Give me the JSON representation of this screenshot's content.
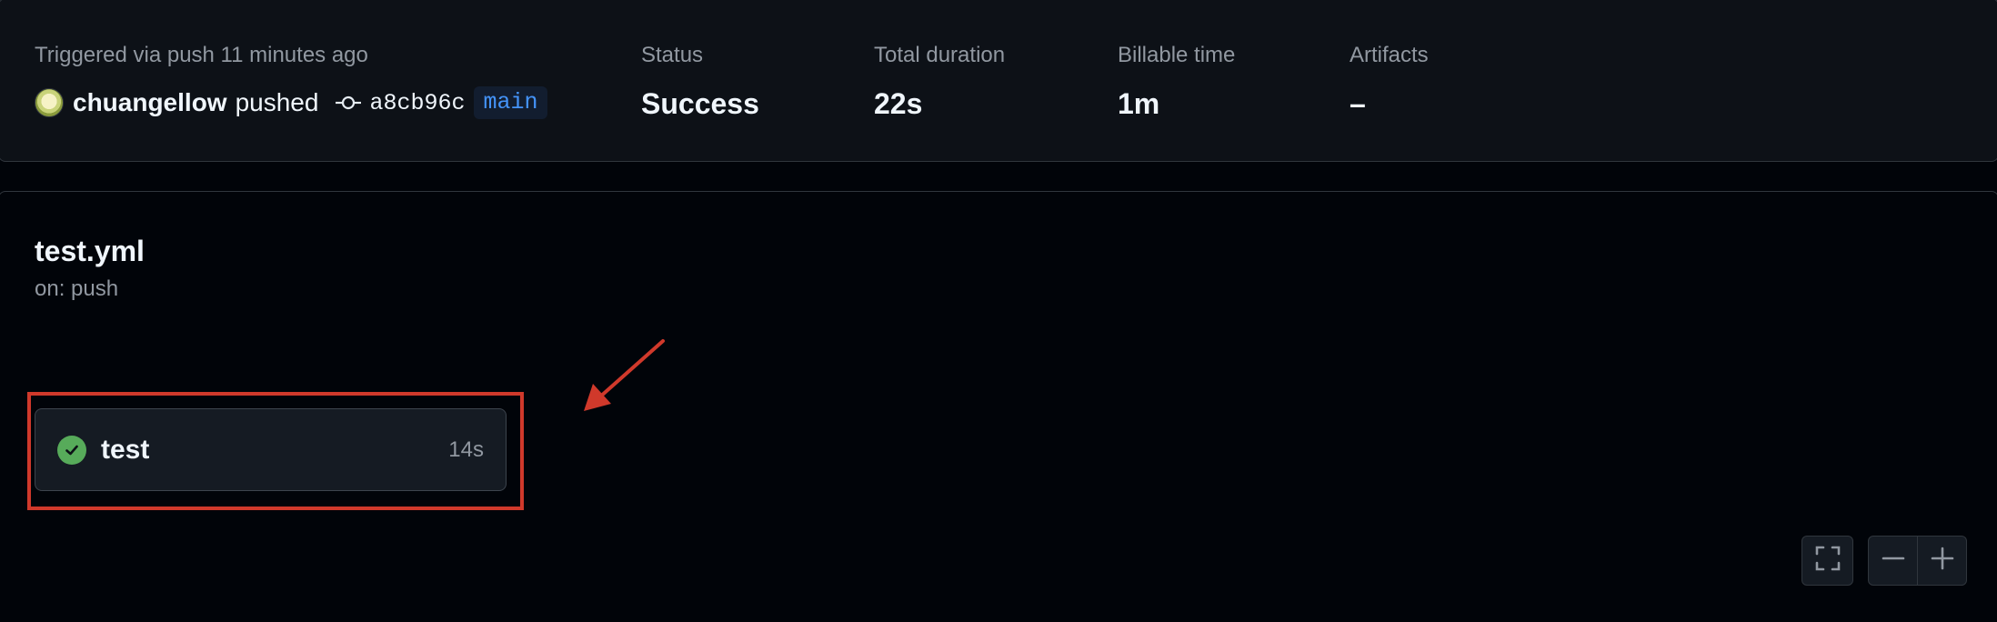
{
  "summary": {
    "trigger_text": "Triggered via push 11 minutes ago",
    "user": "chuangellow",
    "action": "pushed",
    "commit_sha": "a8cb96c",
    "branch": "main",
    "status_label": "Status",
    "status_value": "Success",
    "duration_label": "Total duration",
    "duration_value": "22s",
    "billable_label": "Billable time",
    "billable_value": "1m",
    "artifacts_label": "Artifacts",
    "artifacts_value": "–"
  },
  "workflow": {
    "file": "test.yml",
    "trigger": "on: push"
  },
  "job": {
    "name": "test",
    "duration": "14s",
    "status_color": "#57ab5a"
  },
  "annotation_color": "#d0392b",
  "controls": {
    "fullscreen_icon": "fullscreen-icon",
    "zoom_out_icon": "minus-icon",
    "zoom_in_icon": "plus-icon"
  }
}
